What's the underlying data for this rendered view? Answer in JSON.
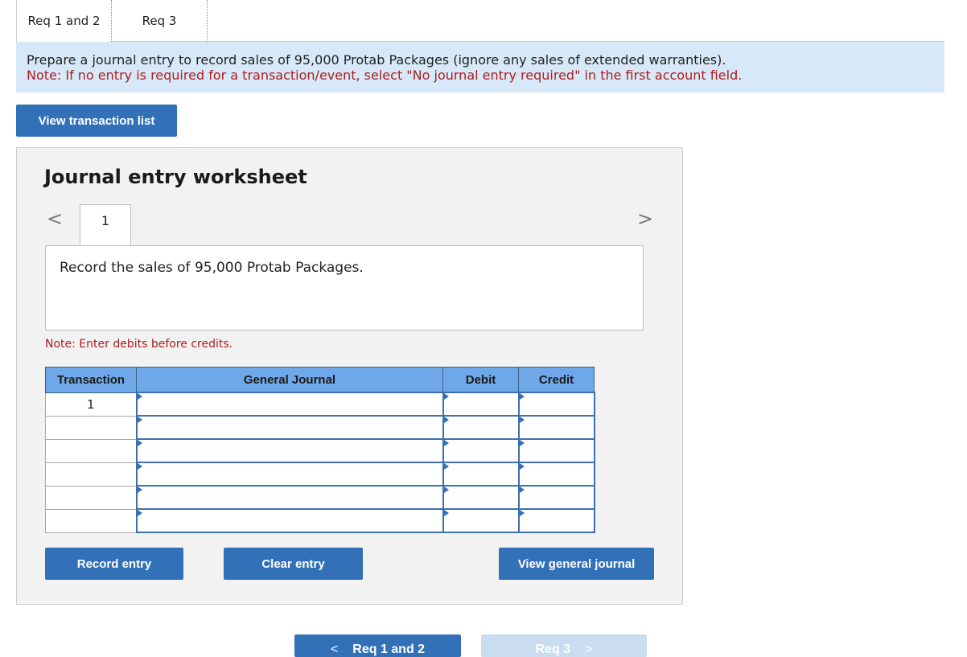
{
  "tabs": [
    {
      "label": "Req 1 and 2"
    },
    {
      "label": "Req 3"
    }
  ],
  "instructions": {
    "main": "Prepare a journal entry to record sales of 95,000 Protab Packages (ignore any sales of extended warranties).",
    "note": "Note: If no entry is required for a transaction/event, select \"No journal entry required\" in the first account field."
  },
  "view_transaction_list_label": "View transaction list",
  "worksheet": {
    "title": "Journal entry worksheet",
    "prev_icon": "chevron-left-icon",
    "next_icon": "chevron-right-icon",
    "entry_number": "1",
    "description": "Record the sales of 95,000 Protab Packages.",
    "note": "Note: Enter debits before credits.",
    "table": {
      "headers": [
        "Transaction",
        "General Journal",
        "Debit",
        "Credit"
      ],
      "rows": [
        {
          "transaction": "1",
          "account": "",
          "debit": "",
          "credit": ""
        },
        {
          "transaction": "",
          "account": "",
          "debit": "",
          "credit": ""
        },
        {
          "transaction": "",
          "account": "",
          "debit": "",
          "credit": ""
        },
        {
          "transaction": "",
          "account": "",
          "debit": "",
          "credit": ""
        },
        {
          "transaction": "",
          "account": "",
          "debit": "",
          "credit": ""
        },
        {
          "transaction": "",
          "account": "",
          "debit": "",
          "credit": ""
        }
      ]
    },
    "buttons": {
      "record": "Record entry",
      "clear": "Clear entry",
      "view_journal": "View general journal"
    }
  },
  "bottom_nav": {
    "prev_label": "Req 1 and 2",
    "prev_chevron": "<",
    "next_label": "Req 3",
    "next_chevron": ">"
  },
  "colors": {
    "primary_button": "#3271b8",
    "banner_bg": "#d7e9f8",
    "table_header": "#6fa8e8",
    "note_red": "#b01c1c",
    "disabled_button": "#c9dcf0"
  }
}
